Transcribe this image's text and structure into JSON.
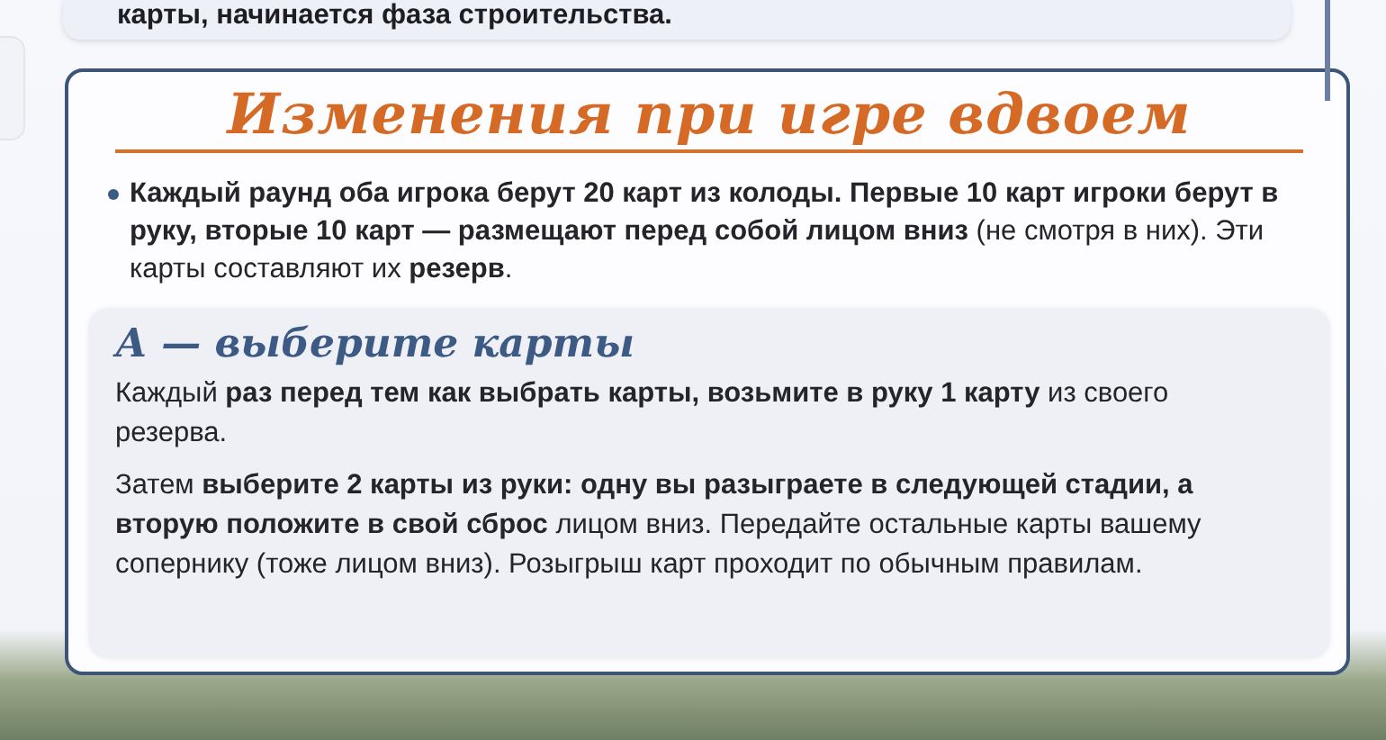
{
  "top_card": {
    "text": "карты, начинается фаза строительства."
  },
  "section": {
    "title": "Изменения при игре вдвоем",
    "bullets": [
      "**Каждый раунд оба игрока берут 20 карт из колоды. Первые 10 карт игроки берут в руку, вторые 10 карт — размещают перед собой лицом вниз** (не смотря в них). Эти карты составляют их **резерв**."
    ],
    "subsection": {
      "title": "А — выберите карты",
      "paragraphs": [
        "Каждый **раз перед тем как выбрать карты, возьмите в руку 1 карту** из своего резерва.",
        "Затем **выберите 2 карты из руки: одну вы разыграете в следующей стадии, а вторую положите в свой сброс** лицом вниз. Передайте остальные карты вашему сопернику (тоже лицом вниз). Розыгрыш карт проходит по обычным правилам."
      ]
    }
  }
}
